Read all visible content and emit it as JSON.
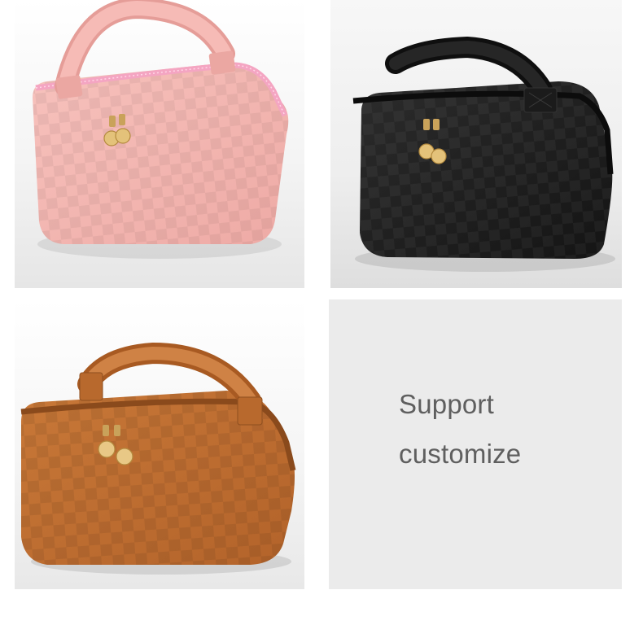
{
  "products": [
    {
      "id": "pink",
      "color_name": "pink",
      "body_color": "#f2b2ae",
      "zipper_color": "#f4a5c2"
    },
    {
      "id": "black",
      "color_name": "black",
      "body_color": "#1e1e1e",
      "zipper_color": "#0c0c0c"
    },
    {
      "id": "brown",
      "color_name": "brown",
      "body_color": "#c06f32",
      "zipper_color": "#8a4a1c"
    }
  ],
  "promo": {
    "line1": "Support",
    "line2": "customize",
    "background": "#ebebeb",
    "text_color": "#5f5f5f"
  }
}
